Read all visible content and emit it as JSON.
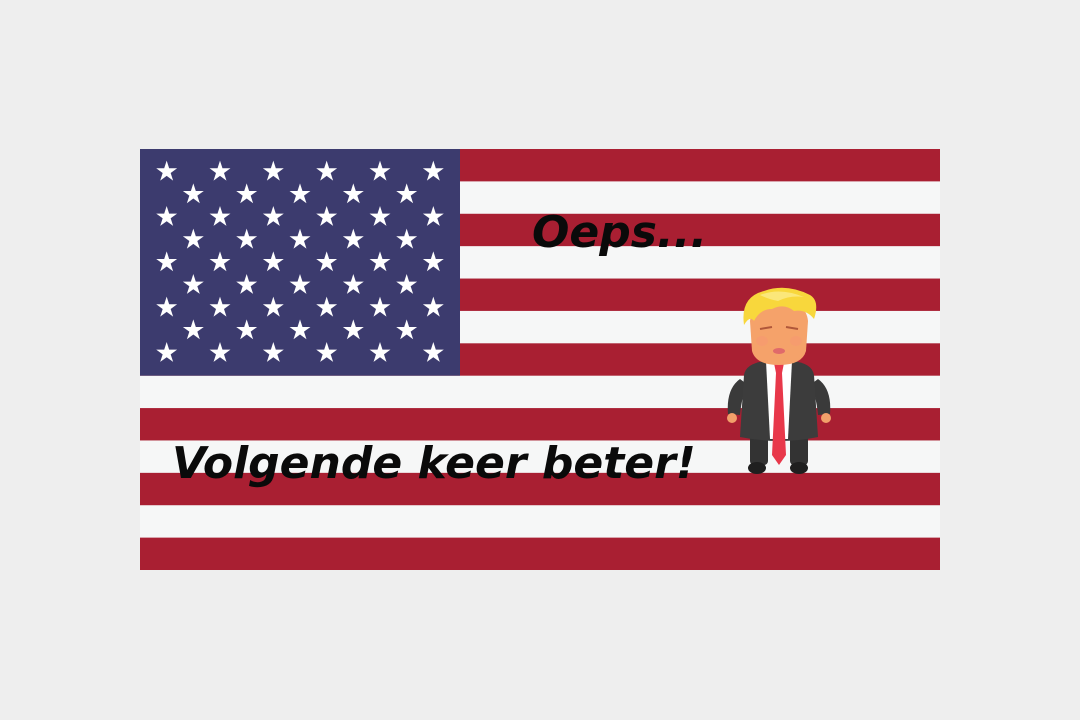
{
  "screen": {
    "title": "Oeps...",
    "message": "Volgende keer beter!"
  },
  "flag": {
    "name": "us-flag",
    "stripe_count": 13,
    "star_rows": [
      6,
      5,
      6,
      5,
      6,
      5,
      6,
      5,
      6
    ],
    "colors": {
      "red": "#a91f32",
      "white": "#f6f7f7",
      "blue": "#3c3b6e",
      "star": "#ffffff"
    }
  },
  "character": {
    "icon": "cartoon-president-icon",
    "colors": {
      "hair": "#f8d73c",
      "skin": "#f5a26a",
      "suit": "#3c3c3c",
      "shirt": "#ffffff",
      "tie": "#e8384a"
    }
  },
  "background_color": "#eeeeee"
}
